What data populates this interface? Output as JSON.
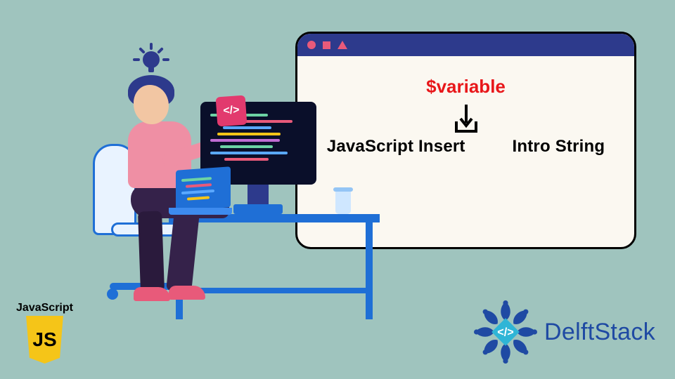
{
  "window": {
    "variable": "$variable",
    "textLeft": "JavaScript Insert",
    "textRight": "Intro String"
  },
  "codeTag": "</>",
  "js": {
    "label": "JavaScript",
    "badge": "JS"
  },
  "brand": "DelftStack",
  "colors": {
    "codeLines": [
      "#6dd3a4",
      "#e85a7a",
      "#5aa8ff",
      "#f5c518",
      "#c06dd3",
      "#6dd3a4",
      "#5aa8ff",
      "#e85a7a"
    ]
  }
}
